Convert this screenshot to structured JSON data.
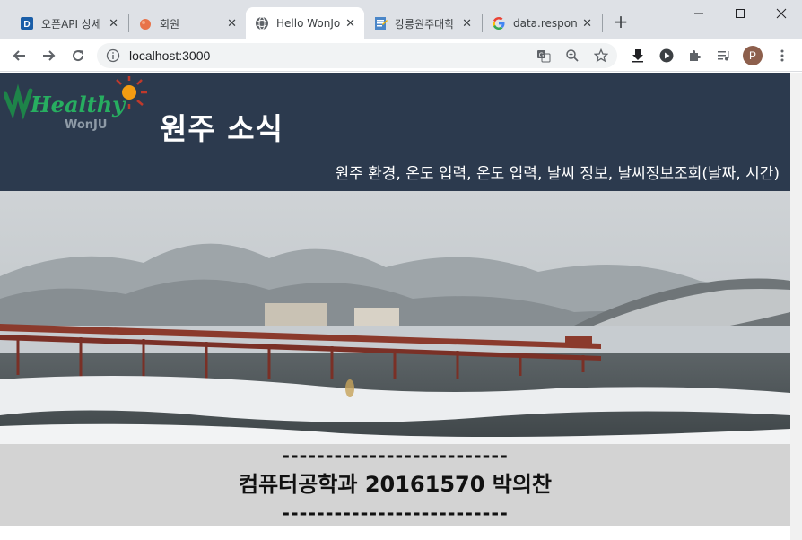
{
  "browser": {
    "tabs": [
      {
        "title": "오픈API 상세",
        "icon": "d-icon"
      },
      {
        "title": "회원",
        "icon": "orange-blob-icon"
      },
      {
        "title": "Hello WonJo",
        "icon": "globe-icon",
        "active": true
      },
      {
        "title": "강릉원주대학",
        "icon": "doc-icon"
      },
      {
        "title": "data.respons",
        "icon": "google-icon"
      }
    ],
    "url": "localhost:3000",
    "profile_initial": "P"
  },
  "page": {
    "logo_text": "Healthy",
    "logo_sub": "WonJU",
    "title": "원주 소식",
    "subtitle": "원주 환경, 온도 입력, 온도 입력, 날씨 정보, 날씨정보조회(날짜, 시간)",
    "dashes_top": "--------------------------",
    "student": "컴퓨터공학과 20161570 박의찬",
    "dashes_bottom": "--------------------------"
  },
  "colors": {
    "header_bg": "#2c3a4e",
    "page_bg": "#d3d3d3",
    "tabbar_bg": "#dee1e6"
  }
}
